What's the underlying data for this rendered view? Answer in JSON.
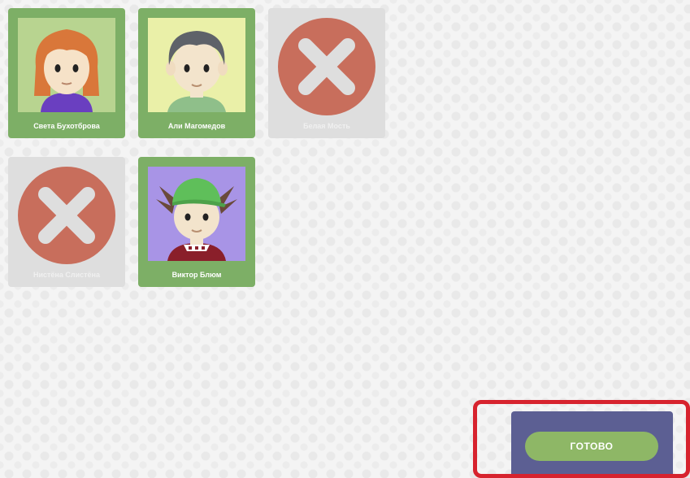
{
  "players": [
    {
      "name": "Света Бухотброва",
      "status": "active",
      "avatar": "girl-orange-hair-avatar"
    },
    {
      "name": "Али Магомедов",
      "status": "active",
      "avatar": "boy-gray-hair-avatar"
    },
    {
      "name": "Белая Мость",
      "status": "inactive",
      "avatar": "x-mark-icon"
    },
    {
      "name": "Нистёна Слистёна",
      "status": "inactive",
      "avatar": "x-mark-icon"
    },
    {
      "name": "Виктор Блюм",
      "status": "active",
      "avatar": "boy-green-cap-avatar"
    }
  ],
  "done_button": {
    "label": "ГОТОВО"
  },
  "colors": {
    "active_card": "#7daf66",
    "inactive_card": "#dedede",
    "x_circle": "#c86e5c",
    "panel": "#5c5f93",
    "button": "#8eb766",
    "highlight": "#d7232e"
  }
}
